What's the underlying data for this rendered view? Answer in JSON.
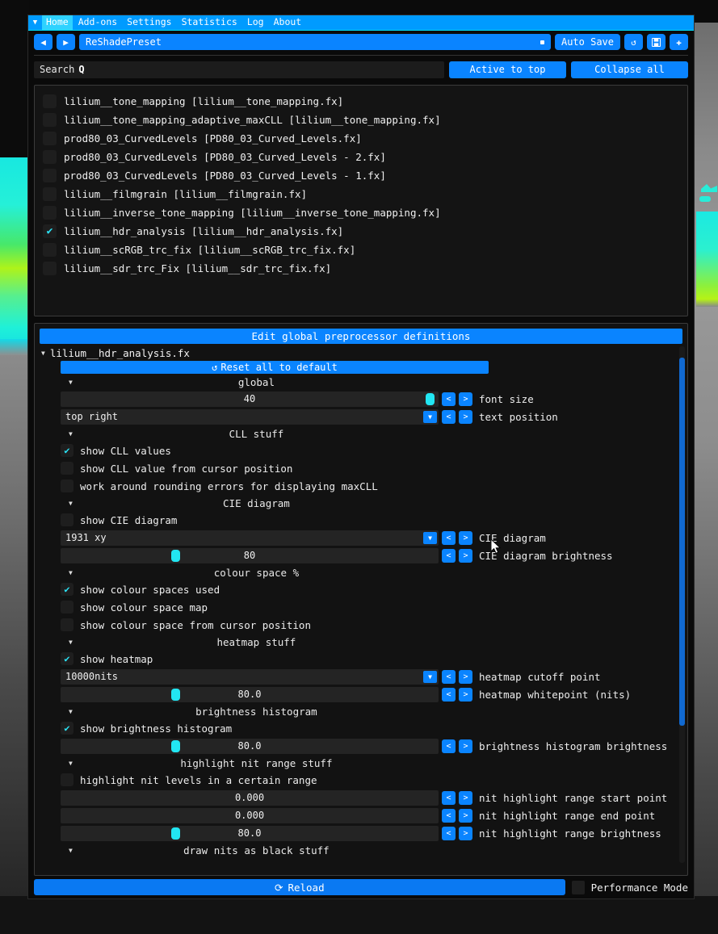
{
  "tabbar": {
    "collapse_icon": "▼",
    "tabs": [
      {
        "label": "Home",
        "active": true
      },
      {
        "label": "Add-ons",
        "active": false
      },
      {
        "label": "Settings",
        "active": false
      },
      {
        "label": "Statistics",
        "active": false
      },
      {
        "label": "Log",
        "active": false
      },
      {
        "label": "About",
        "active": false
      }
    ]
  },
  "preset": {
    "prev_icon": "◀",
    "next_icon": "▶",
    "name": "ReShadePreset",
    "auto_save_label": "Auto Save",
    "reset_icon": "↺",
    "save_icon": "🖫",
    "add_icon": "✚"
  },
  "search": {
    "label": "Search",
    "icon": "search-icon",
    "glyph": "Q",
    "active_to_top_label": "Active to top",
    "collapse_all_label": "Collapse all"
  },
  "shaders": [
    {
      "name": "lilium__tone_mapping [lilium__tone_mapping.fx]",
      "checked": false
    },
    {
      "name": "lilium__tone_mapping_adaptive_maxCLL [lilium__tone_mapping.fx]",
      "checked": false
    },
    {
      "name": "prod80_03_CurvedLevels [PD80_03_Curved_Levels.fx]",
      "checked": false
    },
    {
      "name": "prod80_03_CurvedLevels [PD80_03_Curved_Levels - 2.fx]",
      "checked": false
    },
    {
      "name": "prod80_03_CurvedLevels [PD80_03_Curved_Levels - 1.fx]",
      "checked": false
    },
    {
      "name": "lilium__filmgrain [lilium__filmgrain.fx]",
      "checked": false
    },
    {
      "name": "lilium__inverse_tone_mapping [lilium__inverse_tone_mapping.fx]",
      "checked": false
    },
    {
      "name": "lilium__hdr_analysis [lilium__hdr_analysis.fx]",
      "checked": true
    },
    {
      "name": "lilium__scRGB_trc_fix [lilium__scRGB_trc_fix.fx]",
      "checked": false
    },
    {
      "name": "lilium__sdr_trc_Fix [lilium__sdr_trc_fix.fx]",
      "checked": false
    }
  ],
  "definitions": {
    "edit_global_label": "Edit global preprocessor definitions",
    "fx_file": "lilium__hdr_analysis.fx",
    "reset_all_label": "Reset all to default",
    "reset_icon": "↺",
    "sections": {
      "global": "global",
      "cll": "CLL stuff",
      "cie": "CIE diagram",
      "colour_space": "colour space %",
      "heatmap": "heatmap stuff",
      "histogram": "brightness histogram",
      "highlight": "highlight nit range stuff",
      "draw_black": "draw nits as black stuff"
    },
    "rows": {
      "font_size": {
        "label": "font size",
        "value": "40",
        "handle_pct": 97
      },
      "text_position": {
        "label": "text position",
        "value": "top right"
      },
      "show_cll_values": {
        "label": "show CLL values",
        "checked": true
      },
      "show_cll_cursor": {
        "label": "show CLL value from cursor position",
        "checked": false
      },
      "rounding_errors": {
        "label": "work around rounding errors for displaying maxCLL",
        "checked": false
      },
      "show_cie": {
        "label": "show CIE diagram",
        "checked": false
      },
      "cie_diagram": {
        "label": "CIE diagram",
        "value": "1931 xy"
      },
      "cie_brightness": {
        "label": "CIE diagram brightness",
        "value": "80",
        "handle_pct": 30
      },
      "show_colour_spaces_used": {
        "label": "show colour spaces used",
        "checked": true
      },
      "show_colour_space_map": {
        "label": "show colour space map",
        "checked": false
      },
      "show_colour_space_cursor": {
        "label": "show colour space from cursor position",
        "checked": false
      },
      "show_heatmap": {
        "label": "show heatmap",
        "checked": true
      },
      "heatmap_cutoff": {
        "label": "heatmap cutoff point",
        "value": "10000nits"
      },
      "heatmap_whitepoint": {
        "label": "heatmap whitepoint (nits)",
        "value": "80.0",
        "handle_pct": 30
      },
      "show_histogram": {
        "label": "show brightness histogram",
        "checked": true
      },
      "histogram_brightness": {
        "label": "brightness histogram brightness",
        "value": "80.0",
        "handle_pct": 30
      },
      "highlight_nit_levels": {
        "label": "highlight nit levels in a certain range",
        "checked": false
      },
      "nit_range_start": {
        "label": "nit highlight range start point",
        "value": "0.000"
      },
      "nit_range_end": {
        "label": "nit highlight range end point",
        "value": "0.000"
      },
      "nit_range_brightness": {
        "label": "nit highlight range brightness",
        "value": "80.0",
        "handle_pct": 30
      }
    },
    "step_down": "<",
    "step_up": ">"
  },
  "bottom": {
    "reload_label": "Reload",
    "reload_icon": "⟳",
    "performance_mode_label": "Performance Mode",
    "performance_mode_checked": false
  },
  "colors": {
    "accent_blue": "#0a84ff",
    "tab_blue": "#009bff",
    "active_tab": "#2fd2ff",
    "slider_cyan": "#22e6f2",
    "check_cyan": "#2be3f5",
    "panel_bg": "#141414",
    "field_bg": "#242424"
  }
}
